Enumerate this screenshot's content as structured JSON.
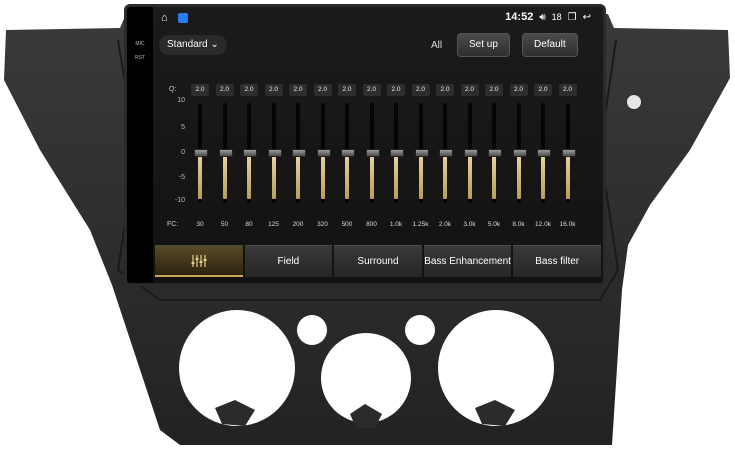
{
  "side_labels": [
    "MIC",
    "RST"
  ],
  "status": {
    "time": "14:52",
    "volume": "18",
    "home_icon": "home-icon",
    "app_icon": "app-store-icon",
    "volume_icon": "speaker-icon",
    "recent_icon": "recent-apps-icon",
    "back_icon": "back-arrow-icon"
  },
  "toolbar": {
    "preset": "Standard",
    "all_label": "All",
    "setup_label": "Set up",
    "default_label": "Default"
  },
  "eq": {
    "q_label": "Q:",
    "fc_label": "FC:",
    "scale": [
      "10",
      "5",
      "0",
      "-5",
      "-10"
    ],
    "bands": [
      {
        "q": "2.0",
        "fc": "30",
        "gain": 0
      },
      {
        "q": "2.0",
        "fc": "50",
        "gain": 0
      },
      {
        "q": "2.0",
        "fc": "80",
        "gain": 0
      },
      {
        "q": "2.0",
        "fc": "125",
        "gain": 0
      },
      {
        "q": "2.0",
        "fc": "200",
        "gain": 0
      },
      {
        "q": "2.0",
        "fc": "320",
        "gain": 0
      },
      {
        "q": "2.0",
        "fc": "500",
        "gain": 0
      },
      {
        "q": "2.0",
        "fc": "800",
        "gain": 0
      },
      {
        "q": "2.0",
        "fc": "1.0k",
        "gain": 0
      },
      {
        "q": "2.0",
        "fc": "1.25k",
        "gain": 0
      },
      {
        "q": "2.0",
        "fc": "2.0k",
        "gain": 0
      },
      {
        "q": "2.0",
        "fc": "3.0k",
        "gain": 0
      },
      {
        "q": "2.0",
        "fc": "5.0k",
        "gain": 0
      },
      {
        "q": "2.0",
        "fc": "8.0k",
        "gain": 0
      },
      {
        "q": "2.0",
        "fc": "12.0k",
        "gain": 0
      },
      {
        "q": "2.0",
        "fc": "16.0k",
        "gain": 0
      }
    ]
  },
  "tabs": [
    {
      "label": "",
      "icon": "equalizer-icon",
      "active": true
    },
    {
      "label": "Field",
      "active": false
    },
    {
      "label": "Surround",
      "active": false
    },
    {
      "label": "Bass Enhancement",
      "active": false
    },
    {
      "label": "Bass filter",
      "active": false
    }
  ],
  "colors": {
    "accent": "#c9a85b",
    "bezel": "#2b2b2b"
  }
}
